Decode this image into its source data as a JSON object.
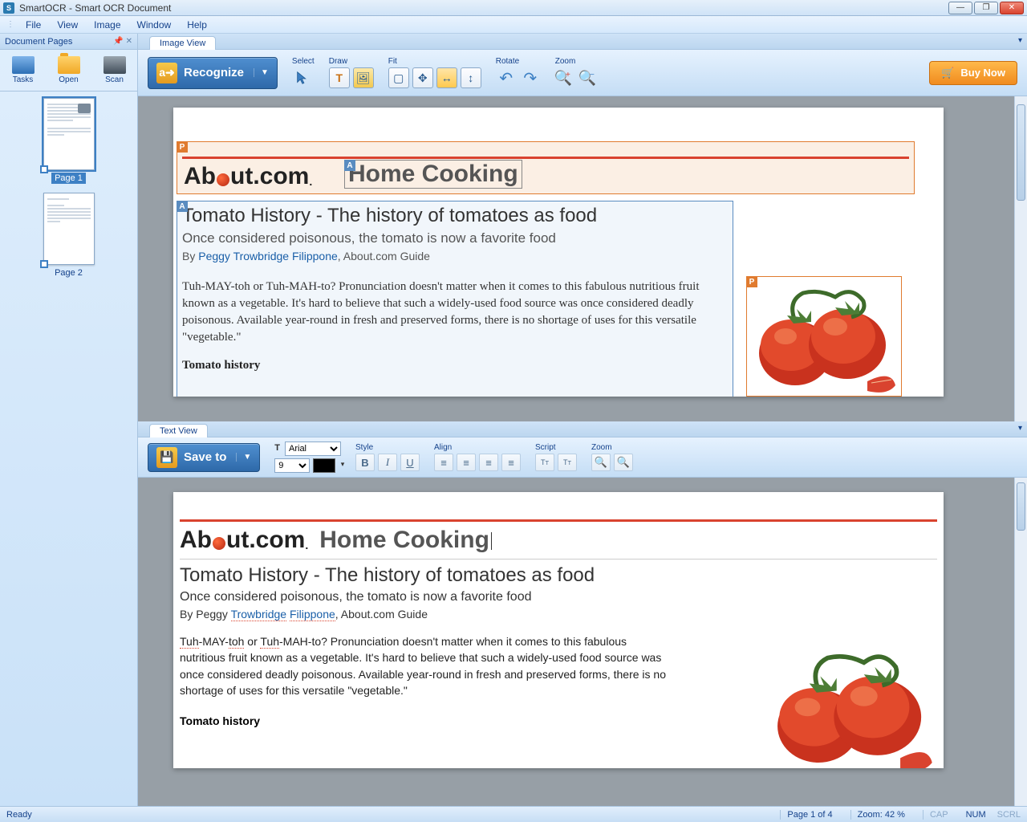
{
  "window": {
    "title": "SmartOCR - Smart OCR Document"
  },
  "menu": {
    "file": "File",
    "view": "View",
    "image": "Image",
    "window": "Window",
    "help": "Help"
  },
  "sidebar": {
    "panel_title": "Document Pages",
    "tools": {
      "tasks": "Tasks",
      "open": "Open",
      "scan": "Scan"
    },
    "pages": [
      {
        "label": "Page 1"
      },
      {
        "label": "Page 2"
      }
    ]
  },
  "imageview": {
    "tab": "Image View",
    "recognize": "Recognize",
    "groups": {
      "select": "Select",
      "draw": "Draw",
      "fit": "Fit",
      "rotate": "Rotate",
      "zoom": "Zoom"
    },
    "buy": "Buy Now"
  },
  "textview": {
    "tab": "Text View",
    "saveto": "Save to",
    "font_name": "Arial",
    "font_size": "9",
    "groups": {
      "style": "Style",
      "align": "Align",
      "script": "Script",
      "zoom": "Zoom"
    }
  },
  "doc": {
    "logo_a": "Ab",
    "logo_b": "ut",
    "logo_c": ".com",
    "logo_dot": ".",
    "site_section": "Home Cooking",
    "headline": "Tomato History - The history of tomatoes as food",
    "subhead": "Once considered poisonous, the tomato is now a favorite food",
    "by": "By ",
    "author": "Peggy Trowbridge Filippone",
    "guide": ", About.com Guide",
    "para": "Tuh-MAY-toh or Tuh-MAH-to? Pronunciation doesn't matter when it comes to this fabulous nutritious fruit known as a vegetable. It's hard to believe that such a widely-used food source was once considered deadly poisonous. Available year-round in fresh and preserved forms, there is no shortage of uses for this versatile \"vegetable.\"",
    "section": "Tomato history"
  },
  "tdoc": {
    "headline": "Tomato History - The history of  tomatoes  as  food",
    "subhead": "Once considered poisonous, the tomato is now a  favorite food",
    "by": "By Peggy ",
    "author_a": "Trowbridge",
    "author_sp": " ",
    "author_b": "Filippone",
    "guide": ", About.com Guide",
    "p_a": "Tuh",
    "p_b": "-MAY-",
    "p_c": "toh",
    "p_d": " or ",
    "p_e": "Tuh",
    "p_f": "-MAH",
    "p_rest": "-to? Pronunciation doesn't matter when it comes to this fabulous nutritious fruit known as a vegetable. It's hard to believe that such a widely-used food source was once considered deadly poisonous. Available year-round in fresh and preserved forms, there is no shortage of uses for this versatile \"vegetable.\"",
    "section": "Tomato history"
  },
  "status": {
    "ready": "Ready",
    "page": "Page 1 of 4",
    "zoom": "Zoom: 42 %",
    "cap": "CAP",
    "num": "NUM",
    "scrl": "SCRL"
  }
}
